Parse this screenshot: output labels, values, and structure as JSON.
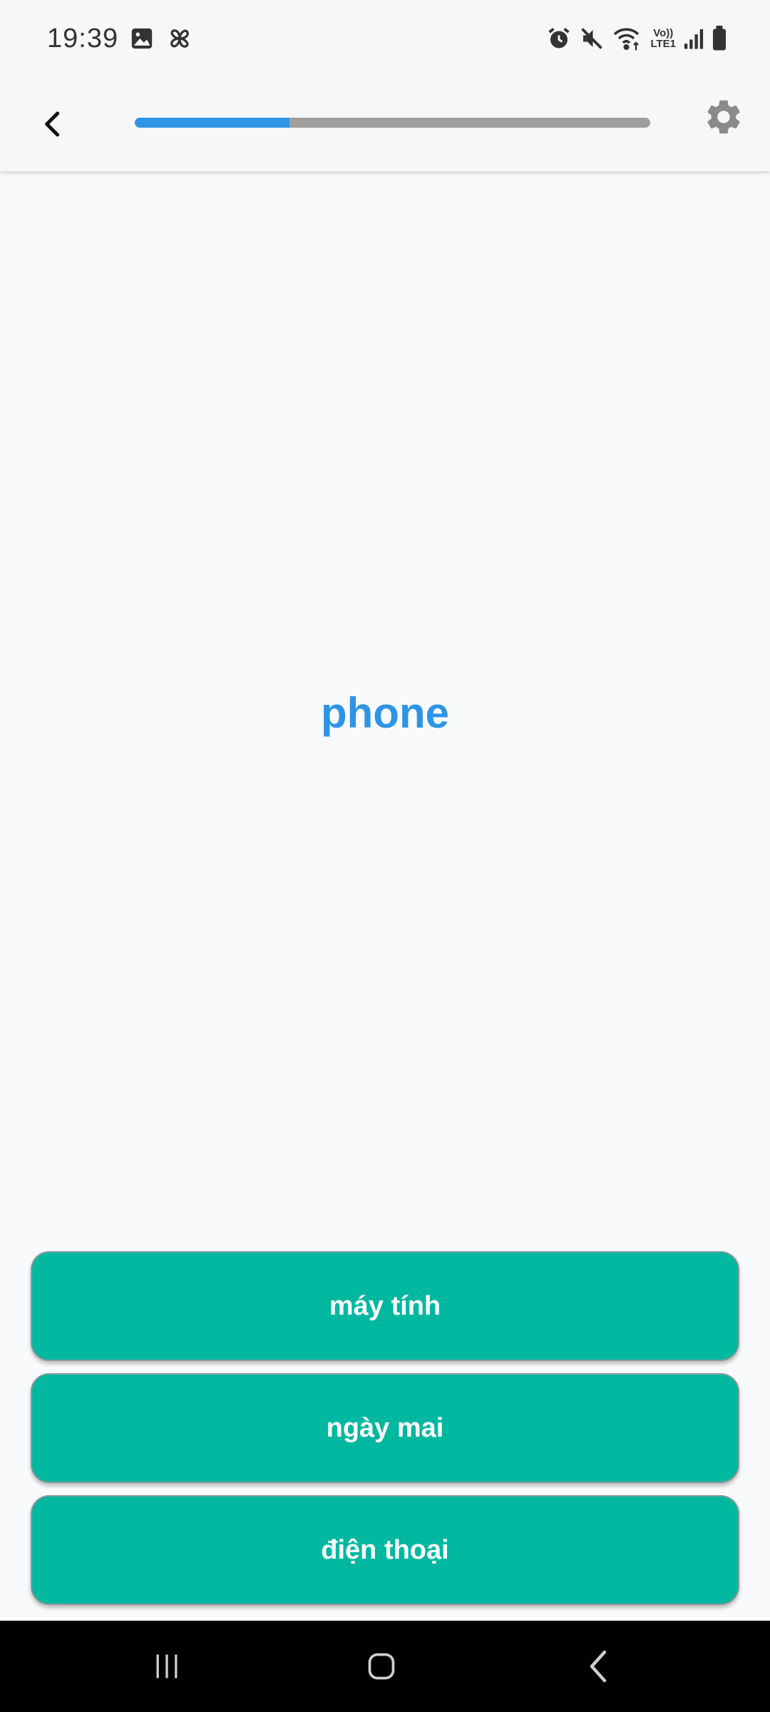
{
  "status_bar": {
    "time": "19:39",
    "left_icons": [
      "gallery-icon",
      "pinwheel-icon"
    ],
    "right_icons": [
      "alarm-icon",
      "mute-icon",
      "wifi-icon",
      "volte-icon",
      "signal-icon",
      "battery-icon"
    ],
    "volte_label_top": "Vo))",
    "volte_label_bottom": "LTE1"
  },
  "app_bar": {
    "back_icon": "chevron-left-icon",
    "settings_icon": "gear-icon",
    "progress": 0.3,
    "progress_color": "#2e95e6",
    "track_color": "#9e9e9e"
  },
  "question": {
    "word": "phone",
    "color": "#2e95e6"
  },
  "answers": [
    {
      "label": "máy tính"
    },
    {
      "label": "ngày mai"
    },
    {
      "label": "điện thoại"
    }
  ],
  "answer_color": "#00b8a0",
  "nav_bar": {
    "icons": [
      "recents-icon",
      "home-icon",
      "back-icon"
    ]
  }
}
